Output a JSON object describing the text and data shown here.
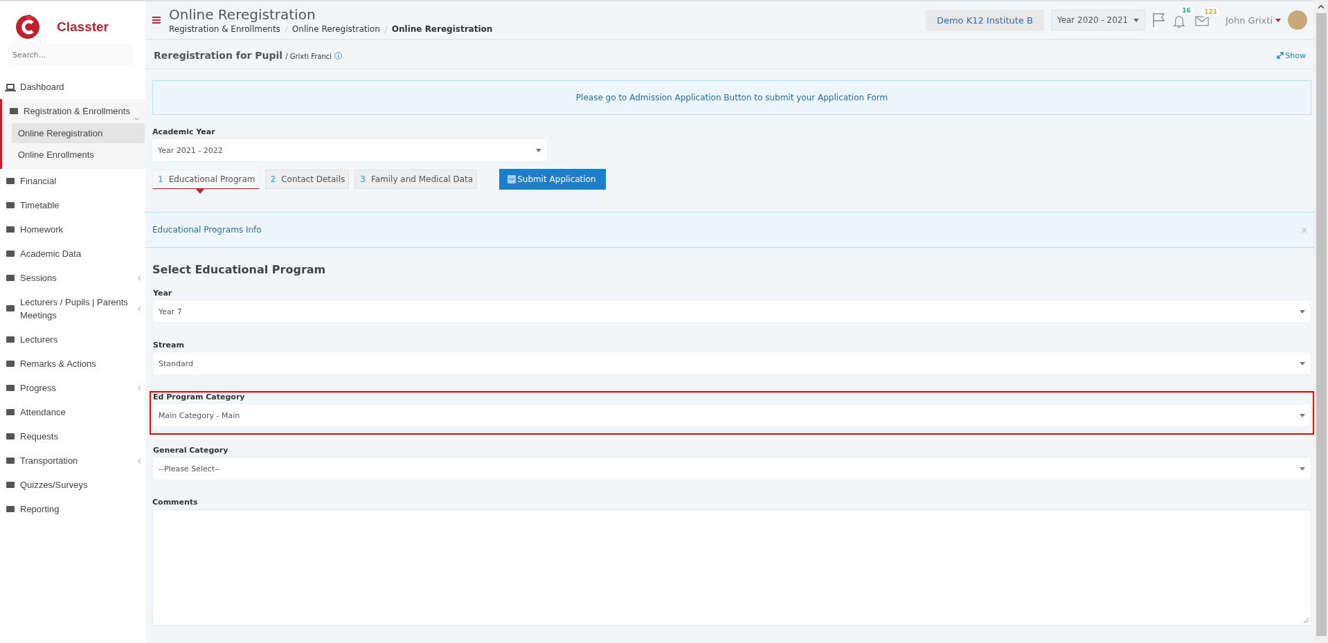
{
  "sidebar": {
    "brand": "Classter",
    "search": {
      "placeholder": "Search..."
    },
    "items": [
      {
        "label": "Dashboard",
        "kind": "link"
      },
      {
        "label": "Registration & Enrollments",
        "kind": "group",
        "expanded": true,
        "children": [
          {
            "label": "Online Reregistration",
            "selected": true
          },
          {
            "label": "Online Enrollments",
            "selected": false
          }
        ]
      },
      {
        "label": "Financial",
        "kind": "link"
      },
      {
        "label": "Timetable",
        "kind": "link"
      },
      {
        "label": "Homework",
        "kind": "link"
      },
      {
        "label": "Academic Data",
        "kind": "link"
      },
      {
        "label": "Sessions",
        "kind": "group",
        "expanded": false
      },
      {
        "label": "Lecturers / Pupils | Parents Meetings",
        "kind": "group",
        "expanded": false
      },
      {
        "label": "Lecturers",
        "kind": "link"
      },
      {
        "label": "Remarks & Actions",
        "kind": "link"
      },
      {
        "label": "Progress",
        "kind": "group",
        "expanded": false
      },
      {
        "label": "Attendance",
        "kind": "link"
      },
      {
        "label": "Requests",
        "kind": "link"
      },
      {
        "label": "Transportation",
        "kind": "group",
        "expanded": false
      },
      {
        "label": "Quizzes/Surveys",
        "kind": "link"
      },
      {
        "label": "Reporting",
        "kind": "link"
      }
    ]
  },
  "header": {
    "title": "Online Reregistration",
    "breadcrumbs": [
      "Registration & Enrollments",
      "Online Reregistration",
      "Online Reregistration"
    ],
    "institute": "Demo K12 Institute B",
    "year": "Year 2020 - 2021",
    "badges": [
      {
        "count": "16",
        "color": "#1aaf8b"
      },
      {
        "count": "121",
        "color": "#f0a030"
      }
    ],
    "user": "John Grixti"
  },
  "subheader": {
    "title": "Reregistration for Pupil",
    "pupil": "/ Grixti Franci",
    "show": "Show"
  },
  "notice": "Please go to Admission Application Button to submit your Application Form",
  "academic_year": {
    "label": "Academic Year",
    "value": "Year 2021 - 2022"
  },
  "steps": [
    {
      "number": "1",
      "label": "Educational Program",
      "selected": true
    },
    {
      "number": "2",
      "label": "Contact Details",
      "selected": false
    },
    {
      "number": "3",
      "label": "Family and Medical Data",
      "selected": false
    }
  ],
  "submit": "Submit Application",
  "info_bar": "Educational Programs Info",
  "section_title": "Select Educational Program",
  "fields": [
    {
      "label": "Year",
      "value": "Year 7",
      "highlighted": false
    },
    {
      "label": "Stream",
      "value": "Standard",
      "highlighted": false
    },
    {
      "label": "Ed Program Category",
      "value": "Main Category - Main",
      "highlighted": true
    },
    {
      "label": "General Category",
      "value": "--Please Select--",
      "highlighted": false
    }
  ],
  "comments": {
    "label": "Comments"
  }
}
